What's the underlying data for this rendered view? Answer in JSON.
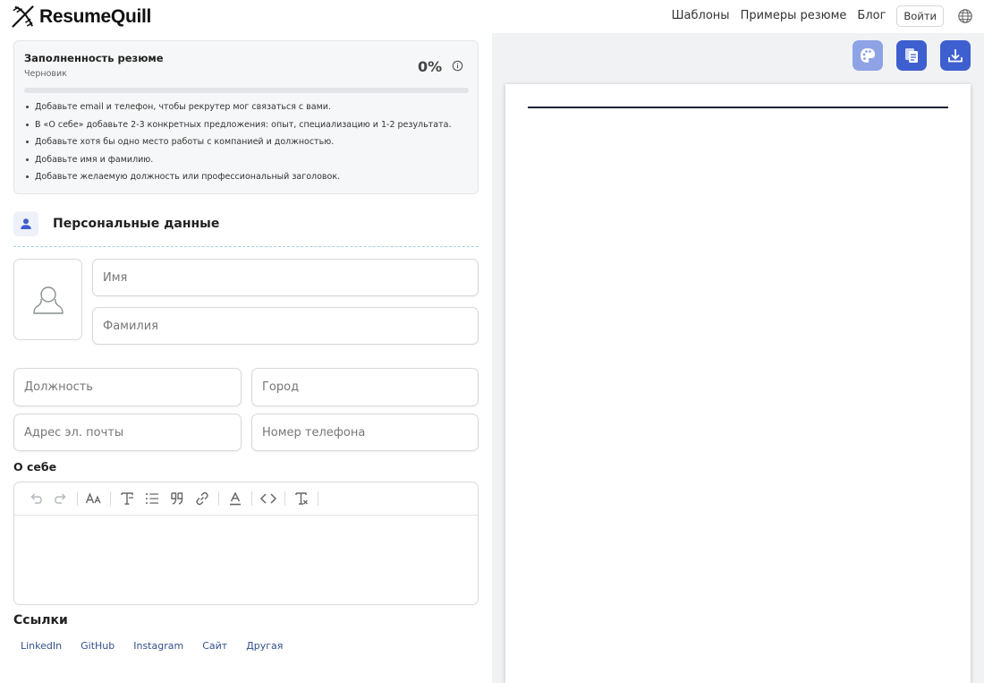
{
  "header": {
    "brand": "ResumeQuill",
    "nav": [
      "Шаблоны",
      "Примеры резюме",
      "Блог"
    ],
    "login_label": "Войти"
  },
  "completeness": {
    "title": "Заполненность резюме",
    "status": "Черновик",
    "percent_label": "0%",
    "progress_fraction": 0,
    "tips": [
      "Добавьте email и телефон, чтобы рекрутер мог связаться с вами.",
      "В «О себе» добавьте 2-3 конкретных предложения: опыт, специализацию и 1-2 результата.",
      "Добавьте хотя бы одно место работы с компанией и должностью.",
      "Добавьте имя и фамилию.",
      "Добавьте желаемую должность или профессиональный заголовок."
    ]
  },
  "personal": {
    "section_title": "Персональные данные",
    "first_name": {
      "value": "",
      "placeholder": "Имя"
    },
    "last_name": {
      "value": "",
      "placeholder": "Фамилия"
    },
    "job_title": {
      "value": "",
      "placeholder": "Должность"
    },
    "city": {
      "value": "",
      "placeholder": "Город"
    },
    "email": {
      "value": "",
      "placeholder": "Адрес эл. почты"
    },
    "phone": {
      "value": "",
      "placeholder": "Номер телефона"
    }
  },
  "about": {
    "label": "О себе",
    "toolbar_icons": [
      "undo-icon",
      "redo-icon",
      "font-size-icon",
      "heading-icon",
      "bullet-list-icon",
      "quote-icon",
      "link-icon",
      "text-color-icon",
      "code-icon",
      "clear-format-icon"
    ]
  },
  "links": {
    "label": "Ссылки",
    "items": [
      "LinkedIn",
      "GitHub",
      "Instagram",
      "Сайт",
      "Другая"
    ]
  },
  "preview": {
    "tools": [
      "palette-icon",
      "copy-icon",
      "download-icon"
    ]
  },
  "colors": {
    "accent": "#3e5fcf",
    "accent_light": "#8ea3e6",
    "preview_bg": "#f1f2f4",
    "link": "#34508c"
  }
}
